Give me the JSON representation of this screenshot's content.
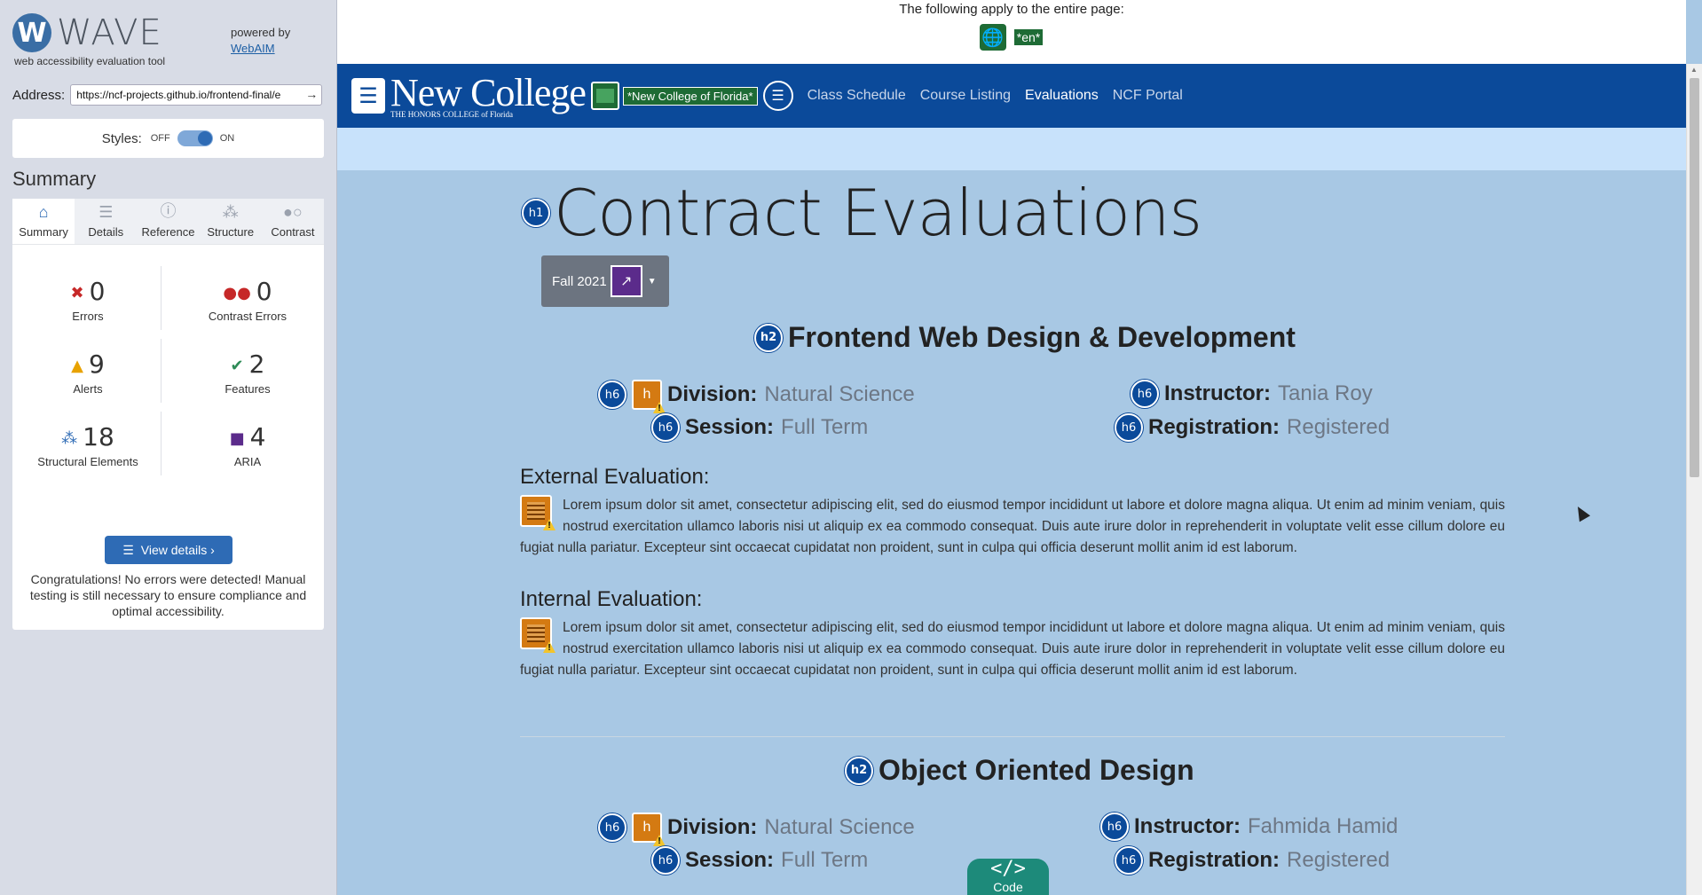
{
  "wave": {
    "brand_letter": "W",
    "brand_name": "WAVE",
    "brand_sub": "web accessibility evaluation tool",
    "powered_by": "powered by",
    "webaim_link": "WebAIM",
    "address_label": "Address:",
    "address_value": "https://ncf-projects.github.io/frontend-final/e",
    "styles_label": "Styles:",
    "styles_off": "OFF",
    "styles_on": "ON",
    "summary_title": "Summary",
    "tabs": [
      {
        "label": "Summary",
        "icon": "home-icon"
      },
      {
        "label": "Details",
        "icon": "list-icon"
      },
      {
        "label": "Reference",
        "icon": "info-icon"
      },
      {
        "label": "Structure",
        "icon": "hierarchy-icon"
      },
      {
        "label": "Contrast",
        "icon": "contrast-icon"
      }
    ],
    "stats": {
      "errors": {
        "num": "0",
        "label": "Errors"
      },
      "contrast_errors": {
        "num": "0",
        "label": "Contrast Errors"
      },
      "alerts": {
        "num": "9",
        "label": "Alerts"
      },
      "features": {
        "num": "2",
        "label": "Features"
      },
      "structural": {
        "num": "18",
        "label": "Structural Elements"
      },
      "aria": {
        "num": "4",
        "label": "ARIA"
      }
    },
    "view_details": "View details ›",
    "congrats": "Congratulations! No errors were detected! Manual testing is still necessary to ensure compliance and optimal accessibility."
  },
  "page": {
    "top_note": "The following apply to the entire page:",
    "lang_tag": "*en*",
    "nav": {
      "logo_big": "New College",
      "logo_small": "THE HONORS COLLEGE of Florida",
      "alt_tag": "*New College of Florida*",
      "links": [
        "Class Schedule",
        "Course Listing",
        "Evaluations",
        "NCF Portal"
      ]
    },
    "h1": "Contract Evaluations",
    "h1_badge": "h1",
    "term_button": "Fall 2021",
    "courses": [
      {
        "title": "Frontend Web Design & Development",
        "division_label": "Division:",
        "division": "Natural Science",
        "session_label": "Session:",
        "session": "Full Term",
        "instructor_label": "Instructor:",
        "instructor": "Tania Roy",
        "registration_label": "Registration:",
        "registration": "Registered",
        "external_label": "External Evaluation:",
        "internal_label": "Internal Evaluation:",
        "external_text": "Lorem ipsum dolor sit amet, consectetur adipiscing elit, sed do eiusmod tempor incididunt ut labore et dolore magna aliqua. Ut enim ad minim veniam, quis nostrud exercitation ullamco laboris nisi ut aliquip ex ea commodo consequat. Duis aute irure dolor in reprehenderit in voluptate velit esse cillum dolore eu fugiat nulla pariatur. Excepteur sint occaecat cupidatat non proident, sunt in culpa qui officia deserunt mollit anim id est laborum.",
        "internal_text": "Lorem ipsum dolor sit amet, consectetur adipiscing elit, sed do eiusmod tempor incididunt ut labore et dolore magna aliqua. Ut enim ad minim veniam, quis nostrud exercitation ullamco laboris nisi ut aliquip ex ea commodo consequat. Duis aute irure dolor in reprehenderit in voluptate velit esse cillum dolore eu fugiat nulla pariatur. Excepteur sint occaecat cupidatat non proident, sunt in culpa qui officia deserunt mollit anim id est laborum."
      },
      {
        "title": "Object Oriented Design",
        "division_label": "Division:",
        "division": "Natural Science",
        "session_label": "Session:",
        "session": "Full Term",
        "instructor_label": "Instructor:",
        "instructor": "Fahmida Hamid",
        "registration_label": "Registration:",
        "registration": "Registered"
      }
    ],
    "h2_badge": "h2",
    "h6_badge": "h6",
    "code_symbol": "</>",
    "code_label": "Code"
  }
}
